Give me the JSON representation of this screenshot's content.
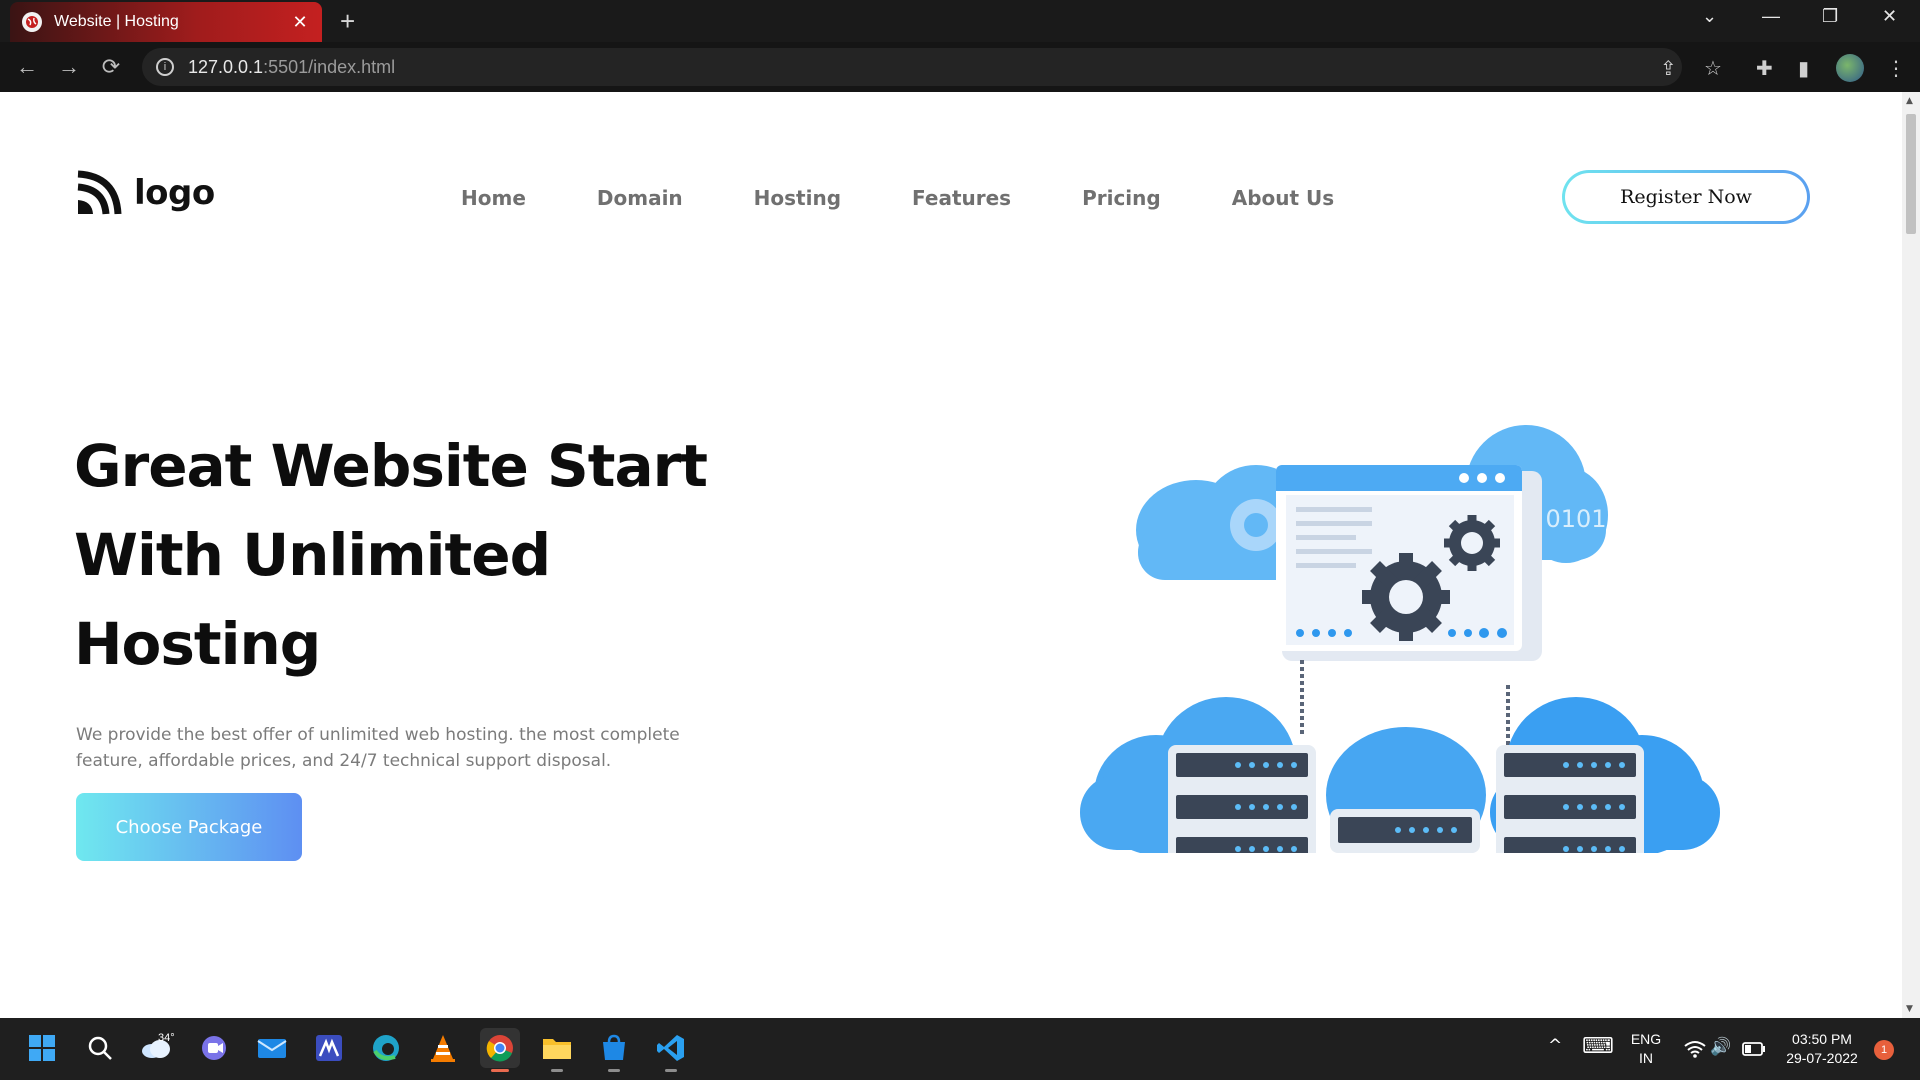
{
  "browser": {
    "tab_title": "Website | Hosting",
    "tab_close": "✕",
    "new_tab": "+",
    "url_host": "127.0.0.1",
    "url_rest": ":5501/index.html",
    "window_controls": {
      "dropdown": "⌄",
      "minimize": "—",
      "restore": "❐",
      "close": "✕"
    },
    "nav": {
      "back": "←",
      "forward": "→",
      "reload": "⟳",
      "info": "i"
    },
    "toolbar_icons": {
      "share": "⇪",
      "bookmark": "☆",
      "extensions": "✚",
      "sidebar": "▮",
      "menu": "⋮"
    }
  },
  "page": {
    "logo_text": "logo",
    "nav_links": [
      "Home",
      "Domain",
      "Hosting",
      "Features",
      "Pricing",
      "About Us"
    ],
    "register_label": "Register Now",
    "hero_title_lines": [
      "Great Website Start",
      "With Unlimited",
      "Hosting"
    ],
    "hero_text": "We provide the best offer of unlimited web hosting. the most complete feature, affordable prices, and 24/7 technical support disposal.",
    "cta_label": "Choose Package",
    "illustration_text": "0101",
    "colors": {
      "accent_start": "#6fe8ef",
      "accent_end": "#5e8ff2",
      "cloud": "#5ab4f5",
      "server": "#3a4556"
    }
  },
  "taskbar": {
    "weather_temp": "34°",
    "language": "ENG",
    "region": "IN",
    "time": "03:50 PM",
    "date": "29-07-2022",
    "notification_count": "1",
    "tray_icons": {
      "chevron": "^",
      "keyboard": "⌨",
      "wifi": "wifi-icon",
      "volume": "🔊",
      "battery": "battery-icon"
    },
    "apps": [
      "start-icon",
      "search-icon",
      "weather-icon",
      "teams-icon",
      "mail-icon",
      "maple-icon",
      "edge-icon",
      "vlc-icon",
      "chrome-icon",
      "file-explorer-icon",
      "store-icon",
      "vscode-icon"
    ]
  }
}
